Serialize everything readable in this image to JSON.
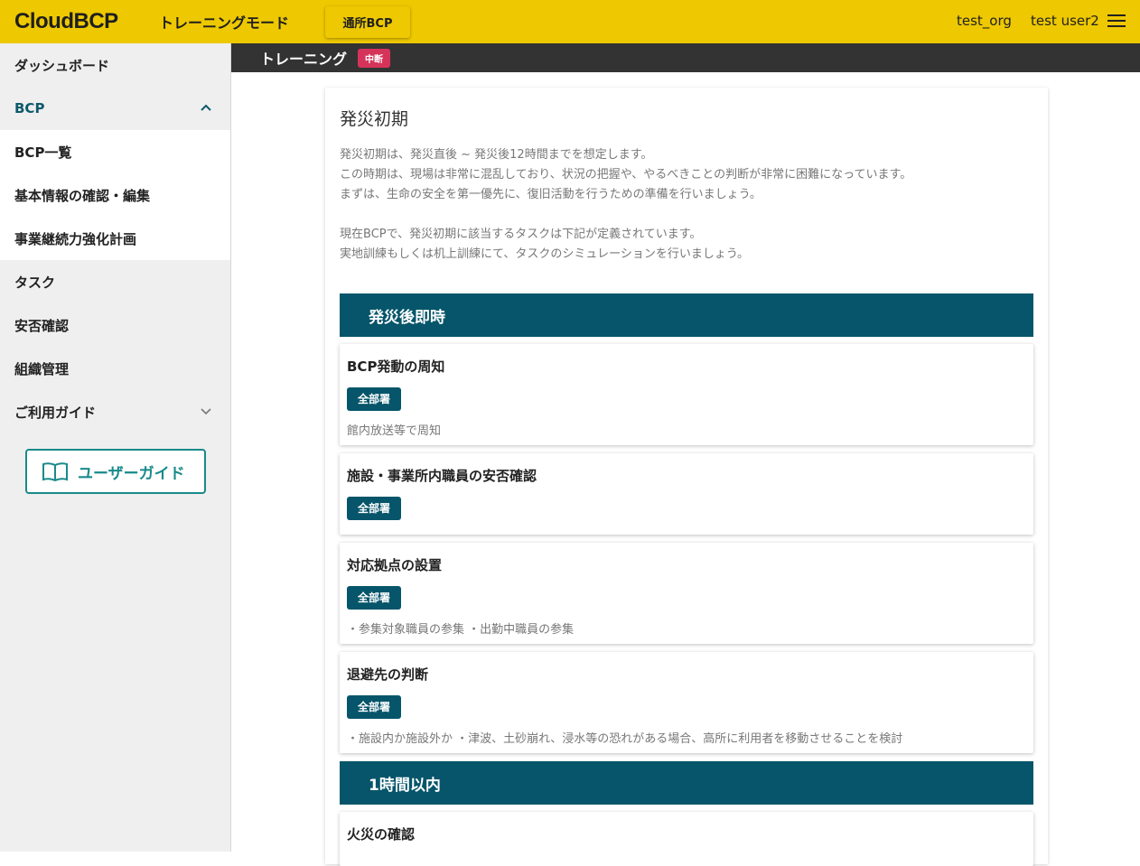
{
  "header": {
    "logo": "CloudBCP",
    "mode_label": "トレーニングモード",
    "button_label": "通所BCP",
    "org": "test_org",
    "user": "test user2"
  },
  "sidebar": {
    "items": [
      {
        "label": "ダッシュボード"
      },
      {
        "label": "BCP"
      },
      {
        "label": "BCP一覧"
      },
      {
        "label": "基本情報の確認・編集"
      },
      {
        "label": "事業継続力強化計画"
      },
      {
        "label": "タスク"
      },
      {
        "label": "安否確認"
      },
      {
        "label": "組織管理"
      },
      {
        "label": "ご利用ガイド"
      }
    ],
    "guide_button": "ユーザーガイド"
  },
  "subbar": {
    "title": "トレーニング",
    "status_badge": "中断"
  },
  "main": {
    "title": "発災初期",
    "intro": [
      "発災初期は、発災直後 ~ 発災後12時間までを想定します。",
      "この時期は、現場は非常に混乱しており、状況の把握や、やるべきことの判断が非常に困難になっています。",
      "まずは、生命の安全を第一優先に、復旧活動を行うための準備を行いましょう。",
      "",
      "現在BCPで、発災初期に該当するタスクは下記が定義されています。",
      "実地訓練もしくは机上訓練にて、タスクのシミュレーションを行いましょう。"
    ],
    "sections": [
      {
        "heading": "発災後即時",
        "tasks": [
          {
            "title": "BCP発動の周知",
            "dept": "全部署",
            "desc": "館内放送等で周知"
          },
          {
            "title": "施設・事業所内職員の安否確認",
            "dept": "全部署",
            "desc": ""
          },
          {
            "title": "対応拠点の設置",
            "dept": "全部署",
            "desc": "・参集対象職員の参集 ・出勤中職員の参集"
          },
          {
            "title": "退避先の判断",
            "dept": "全部署",
            "desc": "・施設内か施設外か ・津波、土砂崩れ、浸水等の恐れがある場合、高所に利用者を移動させることを検討"
          }
        ]
      },
      {
        "heading": "1時間以内",
        "tasks": [
          {
            "title": "火災の確認",
            "dept": "",
            "desc": ""
          }
        ]
      }
    ]
  },
  "colors": {
    "header_bg": "#eec800",
    "subbar_bg": "#333333",
    "section_bg": "#06556a",
    "badge_red": "#d6335b",
    "accent_teal": "#1a8a8a"
  }
}
